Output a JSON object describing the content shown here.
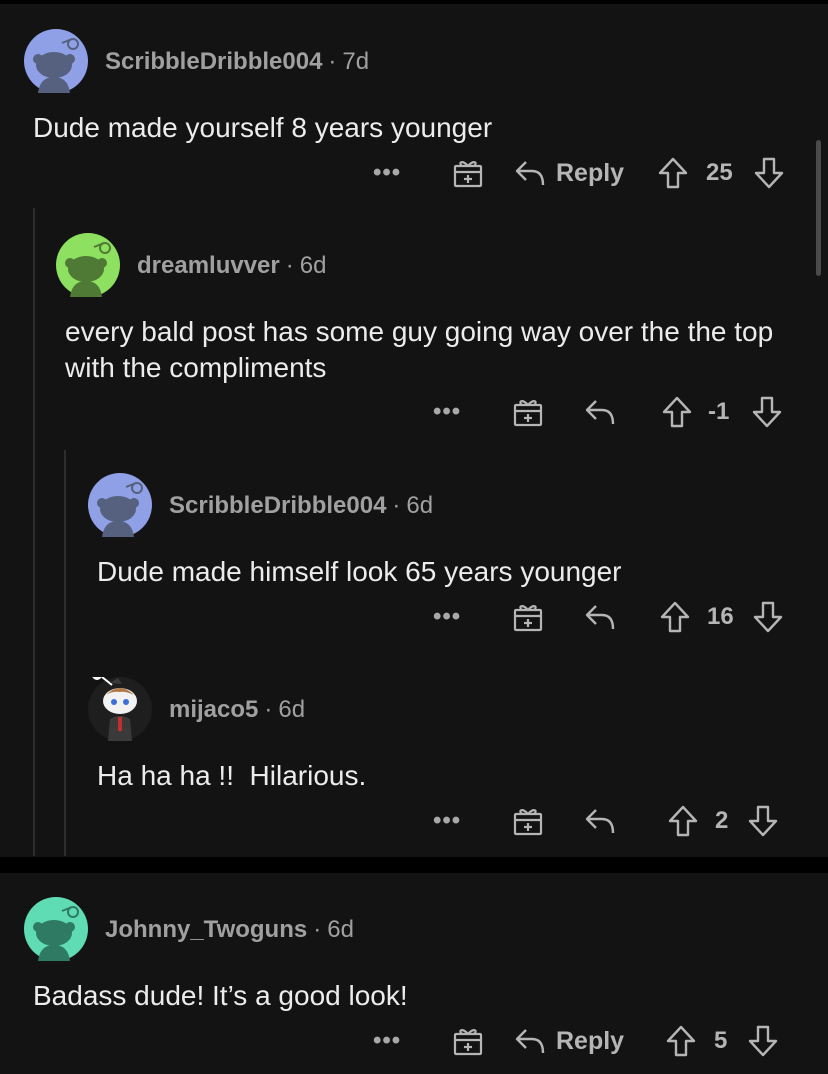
{
  "comments": [
    {
      "username": "ScribbleDribble004",
      "age": "7d",
      "text": "Dude made yourself 8 years younger",
      "more": "•••",
      "reply_label": "Reply",
      "score": "25",
      "avatar_color": "#8fa0e6"
    },
    {
      "username": "dreamluvver",
      "age": "6d",
      "text": "every bald post has some guy going way over the the top with the compliments",
      "more": "•••",
      "reply_label": "",
      "score": "-1",
      "avatar_color": "#8ee060"
    },
    {
      "username": "ScribbleDribble004",
      "age": "6d",
      "text": "Dude made himself look 65 years younger",
      "more": "•••",
      "reply_label": "",
      "score": "16",
      "avatar_color": "#8fa0e6"
    },
    {
      "username": "mijaco5",
      "age": "6d",
      "text": "Ha ha ha !!  Hilarious.",
      "more": "•••",
      "reply_label": "",
      "score": "2",
      "avatar_color": "#1e1e1e"
    },
    {
      "username": "Johnny_Twoguns",
      "age": "6d",
      "text": "Badass dude! It’s a good look!",
      "more": "•••",
      "reply_label": "Reply",
      "score": "5",
      "avatar_color": "#5fdcb4"
    }
  ],
  "icons": {
    "more": "more-options-icon",
    "award": "gift-award-icon",
    "reply": "reply-arrow-icon",
    "upvote": "upvote-arrow-icon",
    "downvote": "downvote-arrow-icon"
  }
}
